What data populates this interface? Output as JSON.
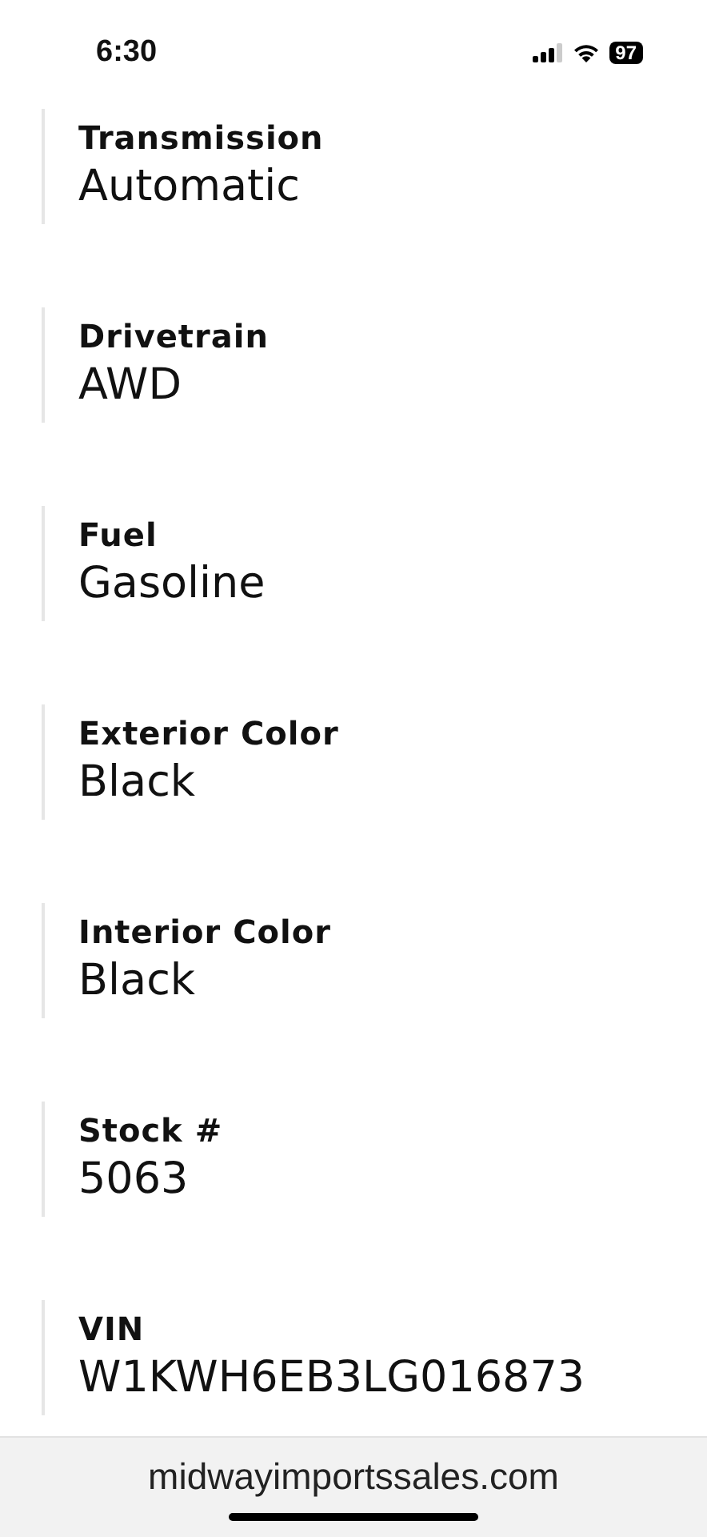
{
  "status_bar": {
    "time": "6:30",
    "battery": "97"
  },
  "specs": [
    {
      "label": "Transmission",
      "value": "Automatic"
    },
    {
      "label": "Drivetrain",
      "value": "AWD"
    },
    {
      "label": "Fuel",
      "value": "Gasoline"
    },
    {
      "label": "Exterior Color",
      "value": "Black"
    },
    {
      "label": "Interior Color",
      "value": "Black"
    },
    {
      "label": "Stock #",
      "value": "5063"
    },
    {
      "label": "VIN",
      "value": "W1KWH6EB3LG016873"
    }
  ],
  "address_bar": {
    "url": "midwayimportssales.com"
  }
}
